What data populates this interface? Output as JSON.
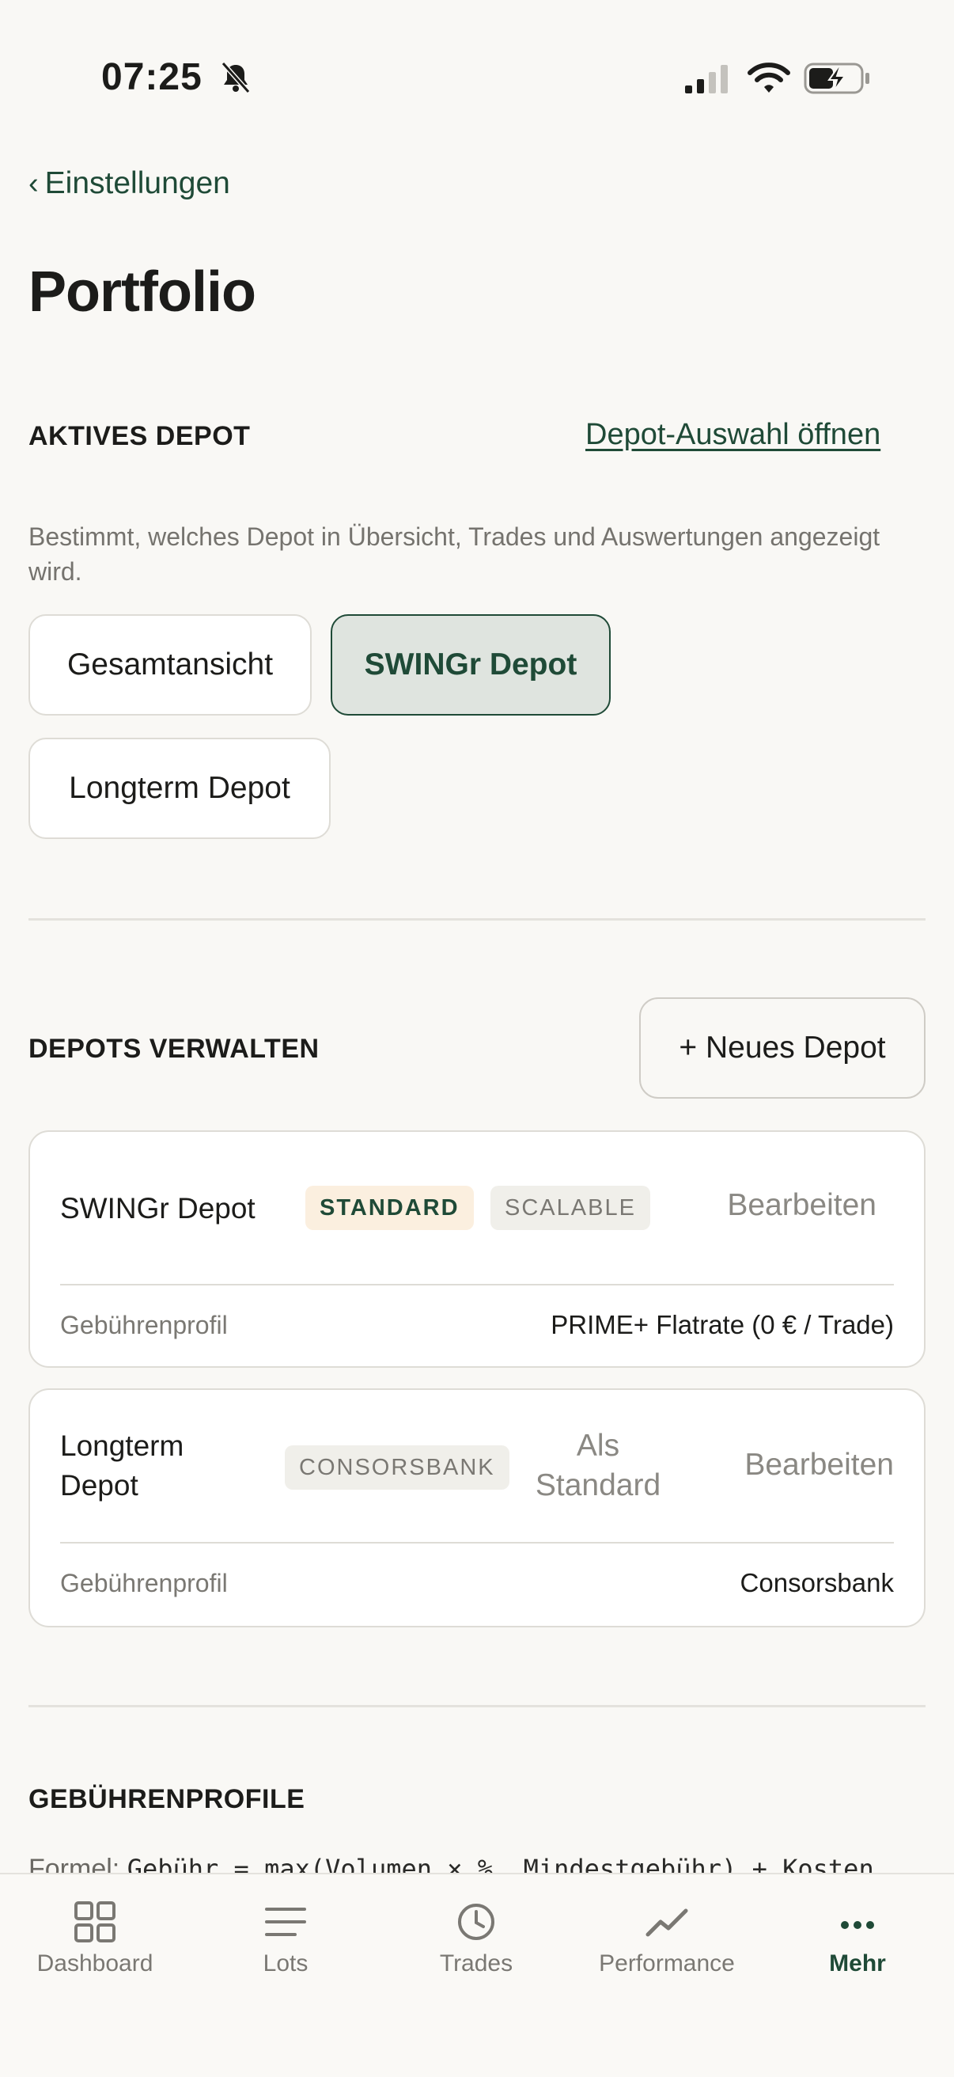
{
  "status": {
    "time": "07:25"
  },
  "nav": {
    "back_label": "Einstellungen"
  },
  "page": {
    "title": "Portfolio"
  },
  "active_depot": {
    "section_label": "AKTIVES DEPOT",
    "open_link": "Depot-Auswahl öffnen",
    "helper": "Bestimmt, welches Depot in Übersicht, Trades und Auswertungen angezeigt wird.",
    "chips": [
      "Gesamtansicht",
      "SWINGr Depot",
      "Longterm Depot"
    ],
    "selected": "SWINGr Depot"
  },
  "manage": {
    "section_label": "DEPOTS VERWALTEN",
    "new_button": "+ Neues Depot",
    "depots": [
      {
        "name": "SWINGr Depot",
        "badges": [
          "STANDARD",
          "SCALABLE"
        ],
        "edit_label": "Bearbeiten",
        "fee_label": "Gebührenprofil",
        "fee_value": "PRIME+ Flatrate (0 € / Trade)"
      },
      {
        "name": "Longterm Depot",
        "badges": [
          "CONSORSBANK"
        ],
        "set_default_label": "Als Standard",
        "edit_label": "Bearbeiten",
        "fee_label": "Gebührenprofil",
        "fee_value": "Consorsbank"
      }
    ]
  },
  "fees": {
    "section_label": "GEBÜHRENPROFILE",
    "formula_label": "Formel:",
    "formula": "Gebühr = max(Volumen × %, Mindestgebühr) + Kosten"
  },
  "tabs": [
    {
      "label": "Dashboard",
      "icon": "grid-icon"
    },
    {
      "label": "Lots",
      "icon": "list-icon"
    },
    {
      "label": "Trades",
      "icon": "clock-icon"
    },
    {
      "label": "Performance",
      "icon": "chart-line-icon"
    },
    {
      "label": "Mehr",
      "icon": "more-icon"
    }
  ],
  "active_tab": "Mehr",
  "colors": {
    "accent": "#1f4a37",
    "background": "#f9f8f5",
    "muted": "#7a7873"
  }
}
